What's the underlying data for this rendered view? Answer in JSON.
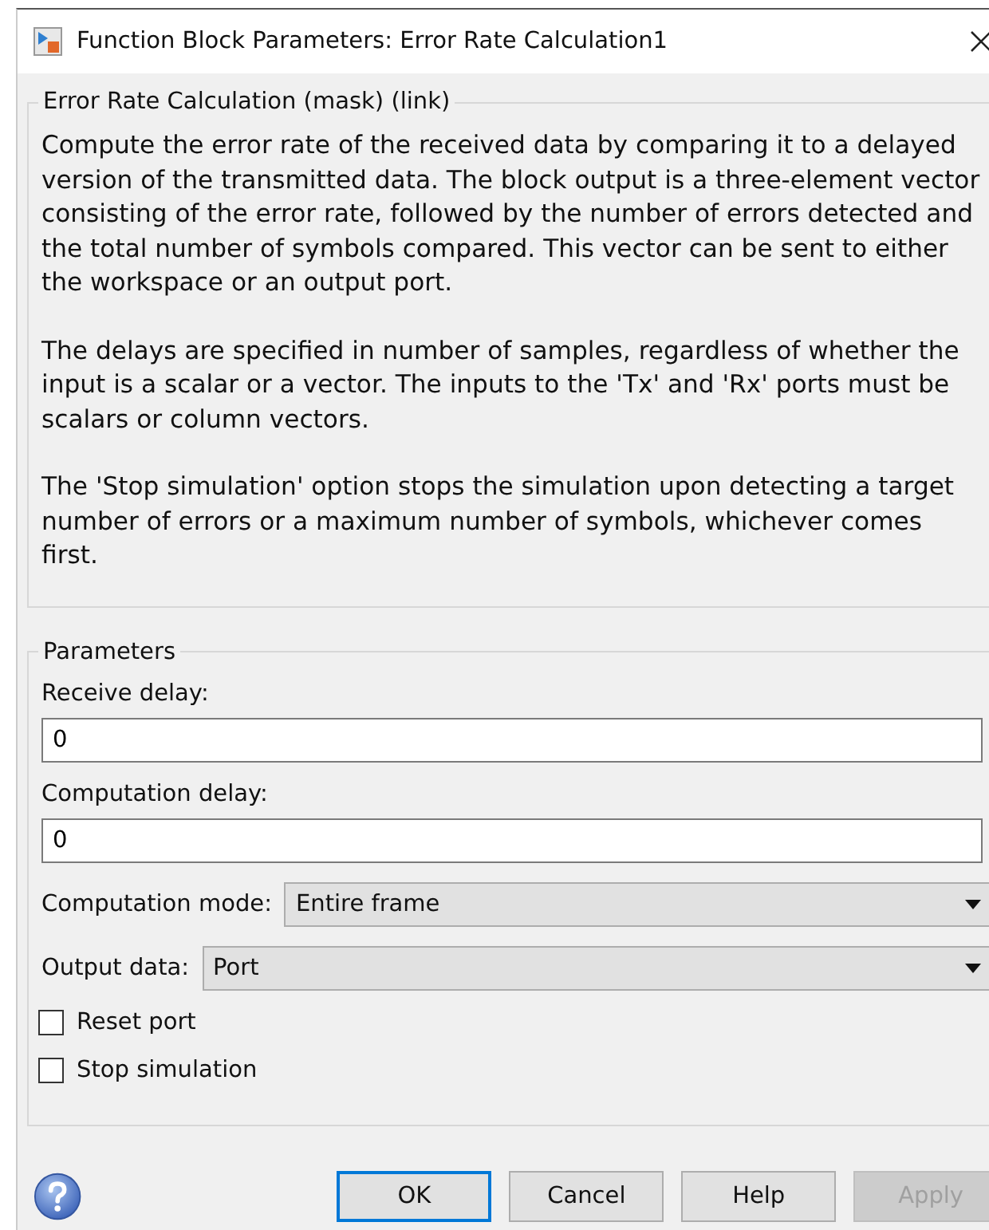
{
  "window": {
    "title": "Function Block Parameters: Error Rate Calculation1"
  },
  "description": {
    "title": "Error Rate Calculation (mask) (link)",
    "paragraphs": [
      "Compute the error rate of the received data by comparing it to a delayed version of the transmitted data. The block output is a three-element vector consisting of the error rate, followed by the number of errors detected and the total number of symbols compared. This vector can be sent to either the workspace or an output port.",
      "The delays are specified in number of samples, regardless of whether the input is a scalar or a vector. The inputs to the 'Tx' and 'Rx' ports must be scalars or column vectors.",
      "The 'Stop simulation' option stops the simulation upon detecting a target number of errors or a maximum number of symbols, whichever comes first."
    ]
  },
  "parameters": {
    "title": "Parameters",
    "fields": [
      {
        "kind": "text",
        "label": "Receive delay:",
        "value": "0"
      },
      {
        "kind": "text",
        "label": "Computation delay:",
        "value": "0"
      },
      {
        "kind": "dropdown",
        "label": "Computation mode:",
        "value": "Entire frame"
      },
      {
        "kind": "dropdown",
        "label": "Output data:",
        "value": "Port"
      },
      {
        "kind": "checkbox",
        "label": "Reset port",
        "checked": false
      },
      {
        "kind": "checkbox",
        "label": "Stop simulation",
        "checked": false
      }
    ]
  },
  "buttons": [
    {
      "label": "OK",
      "disabled": false,
      "default": true
    },
    {
      "label": "Cancel",
      "disabled": false,
      "default": false
    },
    {
      "label": "Help",
      "disabled": false,
      "default": false
    },
    {
      "label": "Apply",
      "disabled": true,
      "default": false
    }
  ]
}
